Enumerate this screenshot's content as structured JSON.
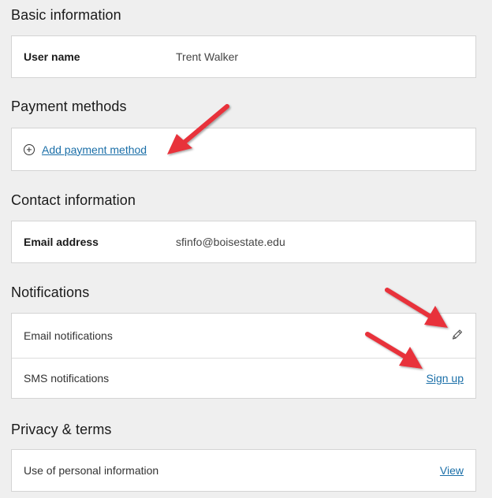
{
  "sections": {
    "basic": {
      "title": "Basic information",
      "user_name_label": "User name",
      "user_name_value": "Trent Walker"
    },
    "payment": {
      "title": "Payment methods",
      "add_label": "Add payment method"
    },
    "contact": {
      "title": "Contact information",
      "email_label": "Email address",
      "email_value": "sfinfo@boisestate.edu"
    },
    "notifications": {
      "title": "Notifications",
      "email_label": "Email notifications",
      "sms_label": "SMS notifications",
      "sms_action": "Sign up"
    },
    "privacy": {
      "title": "Privacy & terms",
      "personal_label": "Use of personal information",
      "personal_action": "View"
    }
  },
  "icons": {
    "add": "plus-circle-icon",
    "edit": "pencil-icon"
  },
  "colors": {
    "link": "#1b6fa8",
    "annotation_arrow": "#e8303a",
    "background": "#efefef"
  }
}
